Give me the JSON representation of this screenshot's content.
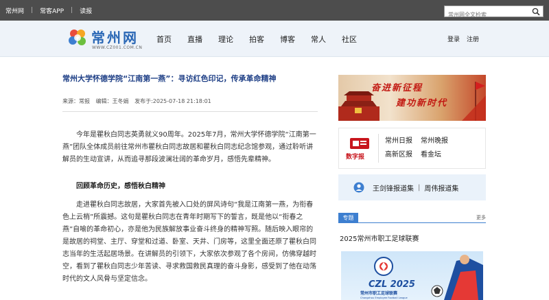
{
  "topbar": {
    "links": [
      "常州网",
      "常客APP",
      "读报"
    ],
    "search_placeholder": "常州网全文检索"
  },
  "header": {
    "logo_name": "常州网",
    "logo_url": "WWW.CZ001.COM.CN",
    "nav": [
      "首页",
      "直播",
      "理论",
      "拍客",
      "博客",
      "常人",
      "社区"
    ],
    "auth": [
      "登录",
      "注册"
    ]
  },
  "article": {
    "headline": "常州大学怀德学院“江南第一燕”：寻访红色印记，传承革命精神",
    "meta": {
      "source": "来源：常报",
      "editor": "编辑：王冬娟",
      "published": "发布于:2025-07-18 21:18:01"
    },
    "para1": "今年是瞿秋白同志英勇就义90周年。2025年7月，常州大学怀德学院“江南第一燕”团队全体成员前往常州市瞿秋白同志故居和瞿秋白同志纪念馆参观，通过聆听讲解员的生动宣讲，从而追寻那段波澜壮阔的革命岁月，感悟先辈精神。",
    "subhead": "回顾革命历史，感悟秋白精神",
    "para2": "走进瞿秋白同志故居，大家首先被入口处的屏风诗句“我是江南第一燕，为衔春色上云梢”所震撼。这句是瞿秋白同志在青年时期写下的誓言，既是他以“衔春之燕”自喻的革命初心，亦是他为民族解放事业奋斗终身的精神写照。随后映入眼帘的是故居的祠堂、主厅、穿堂和过道、卧室、天井、门房等，这里全面还原了瞿秋白同志当年的生活起居场景。在讲解员的引领下，大家依次参观了各个房间，仿佛穿越时空，看到了瞿秋白同志少年苦读、寻求救国救民真理的奋斗身影，感受到了他在动荡时代的文人风骨与坚定信念。"
  },
  "sidebar": {
    "banner": {
      "line1": "奋进新征程",
      "line2": "建功新时代"
    },
    "epaper": {
      "label": "数字报",
      "links": [
        "常州日报",
        "常州晚报",
        "高新区报",
        "看金坛"
      ]
    },
    "reports": [
      "王剑锋报道集",
      "周伟报道集"
    ],
    "topic": {
      "tag": "专题",
      "more": "更多",
      "title": "2025常州市职工足球联赛",
      "poster_brand": "CZL 2025",
      "poster_subtitle": "常州市职工足球联赛",
      "poster_english": "Changzhou Employee Football League"
    }
  },
  "colors": {
    "topbar_bg": "#4d4d4d",
    "header_bg": "#eef3f9",
    "headline": "#1e3f86",
    "accent_blue": "#3d7fd0",
    "accent_red": "#c8161d"
  }
}
